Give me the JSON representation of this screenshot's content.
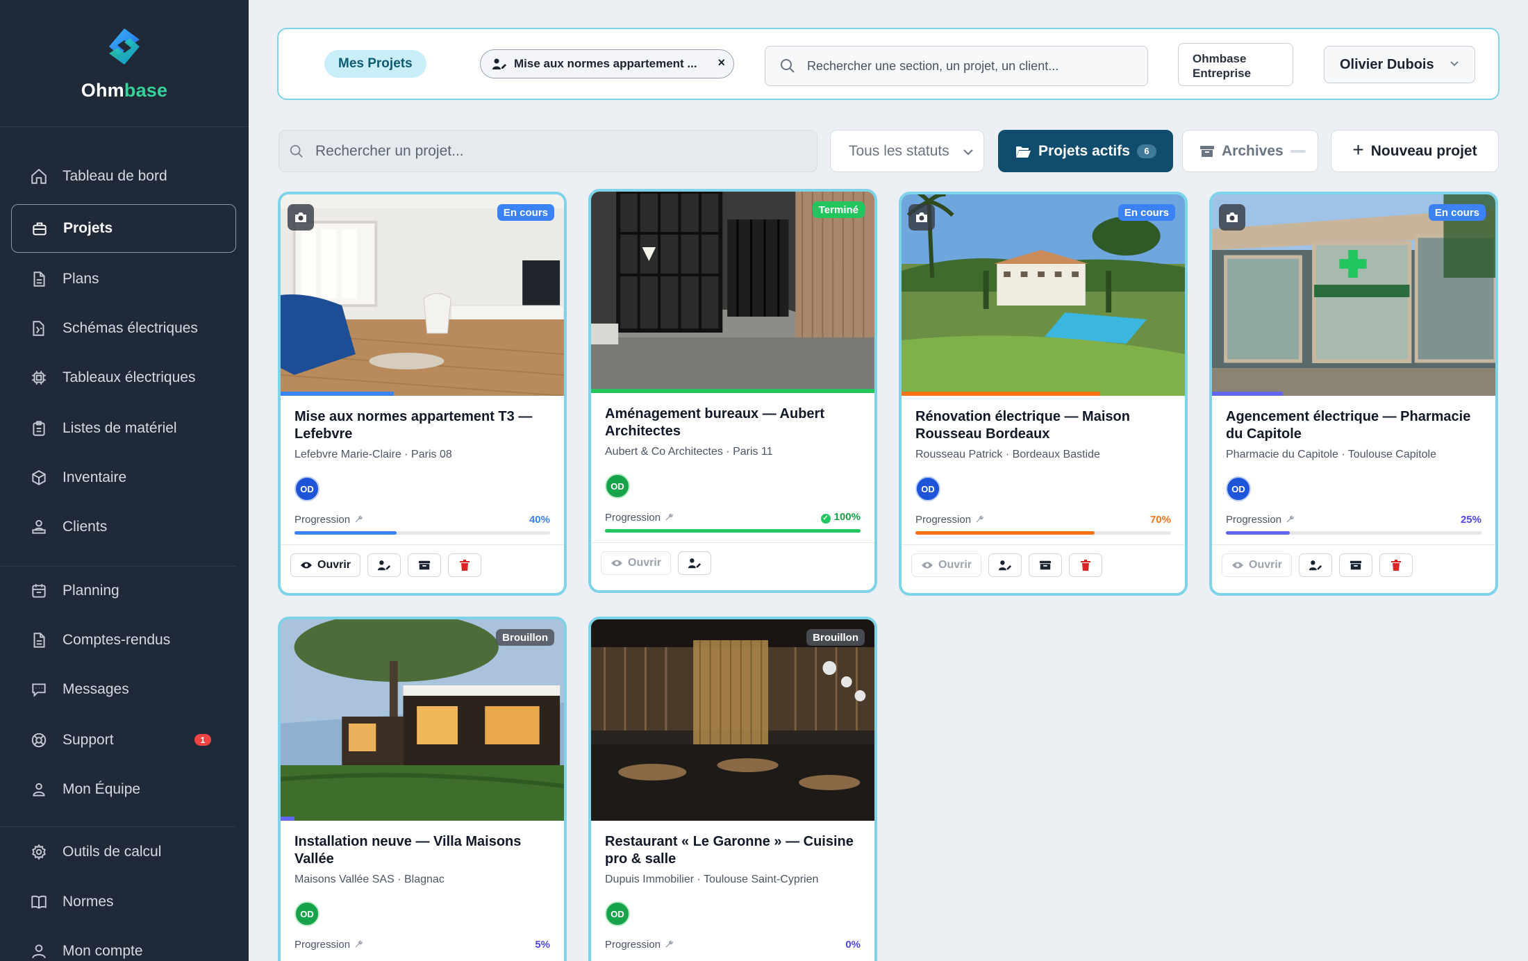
{
  "brand": {
    "name_part1": "Ohm",
    "name_part2": "base"
  },
  "sidebar": {
    "items": [
      {
        "label": "Tableau de bord"
      },
      {
        "label": "Projets"
      },
      {
        "label": "Plans"
      },
      {
        "label": "Schémas électriques"
      },
      {
        "label": "Tableaux électriques"
      },
      {
        "label": "Listes de matériel"
      },
      {
        "label": "Inventaire"
      },
      {
        "label": "Clients"
      },
      {
        "label": "Planning"
      },
      {
        "label": "Comptes-rendus"
      },
      {
        "label": "Messages"
      },
      {
        "label": "Support",
        "badge": "1"
      },
      {
        "label": "Mon Équipe"
      },
      {
        "label": "Outils de calcul"
      },
      {
        "label": "Normes"
      },
      {
        "label": "Mon compte"
      }
    ]
  },
  "topbar": {
    "section_pill": "Mes Projets",
    "project_chip": "Mise aux normes appartement ...",
    "chip_close": "×",
    "search_placeholder": "Rechercher une section, un projet, un client...",
    "company_line1": "Ohmbase",
    "company_line2": "Entreprise",
    "user_name": "Olivier Dubois"
  },
  "filters": {
    "search_placeholder": "Rechercher un projet...",
    "status_select": "Tous les statuts",
    "active_label": "Projets actifs",
    "active_count": "6",
    "archives_label": "Archives",
    "new_label": "Nouveau projet"
  },
  "labels": {
    "progress": "Progression",
    "open": "Ouvrir"
  },
  "projects": [
    {
      "status": "En cours",
      "title": "Mise aux normes appartement T3 — Lefebvre",
      "sub": "Lefebvre Marie-Claire · Paris 08",
      "avatar": "OD",
      "progress_pct": "40%",
      "progress": 0.4,
      "color": "#3b82f6"
    },
    {
      "status": "Terminé",
      "title": "Aménagement bureaux — Aubert Architectes",
      "sub": "Aubert & Co Architectes · Paris 11",
      "avatar": "OD",
      "progress_pct": "100%",
      "progress": 1.0,
      "color": "#22c55e"
    },
    {
      "status": "En cours",
      "title": "Rénovation électrique — Maison Rousseau Bordeaux",
      "sub": "Rousseau Patrick · Bordeaux Bastide",
      "avatar": "OD",
      "progress_pct": "70%",
      "progress": 0.7,
      "color": "#f97316"
    },
    {
      "status": "En cours",
      "title": "Agencement électrique — Pharmacie du Capitole",
      "sub": "Pharmacie du Capitole · Toulouse Capitole",
      "avatar": "OD",
      "progress_pct": "25%",
      "progress": 0.25,
      "color": "#6366f1"
    },
    {
      "status": "Brouillon",
      "title": "Installation neuve — Villa Maisons Vallée",
      "sub": "Maisons Vallée SAS · Blagnac",
      "avatar": "OD",
      "progress_pct": "5%",
      "progress": 0.05,
      "color": "#6366f1"
    },
    {
      "status": "Brouillon",
      "title": "Restaurant « Le Garonne » — Cuisine pro & salle",
      "sub": "Dupuis Immobilier · Toulouse Saint-Cyprien",
      "avatar": "OD",
      "progress_pct": "0%",
      "progress": 0.0,
      "color": "#9ca3af"
    }
  ]
}
